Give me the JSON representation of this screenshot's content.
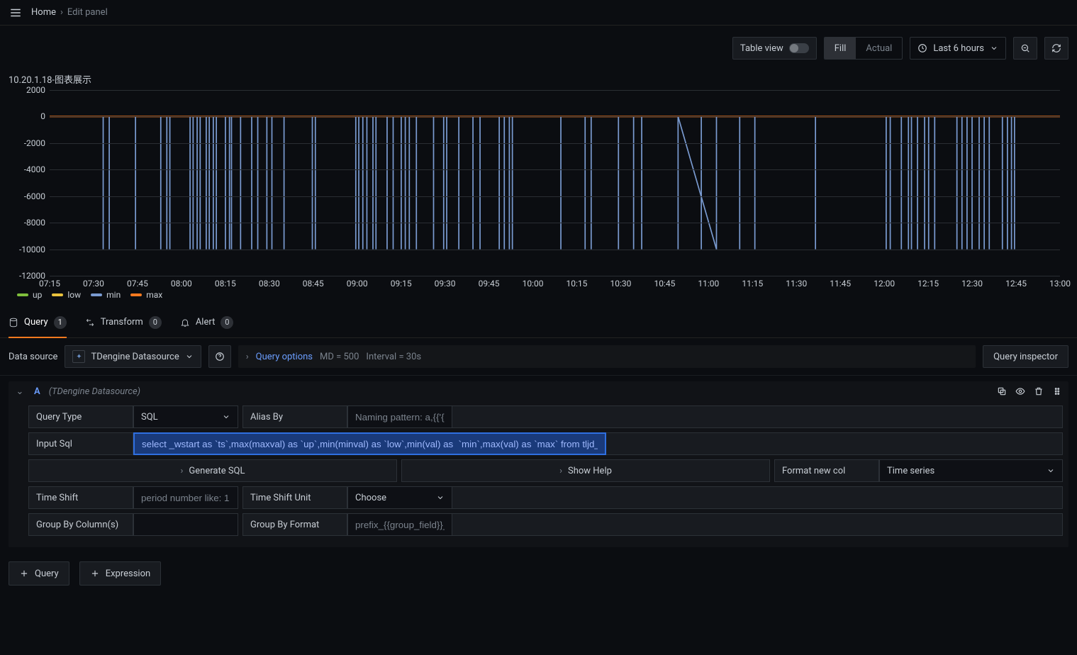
{
  "breadcrumb": {
    "home": "Home",
    "current": "Edit panel"
  },
  "toolbar": {
    "table_view": "Table view",
    "fill": "Fill",
    "actual": "Actual",
    "time_range": "Last 6 hours"
  },
  "panel_title": "10.20.1.18-图表展示",
  "chart_data": {
    "type": "line",
    "title": "10.20.1.18-图表展示",
    "ylabel": "",
    "xlabel": "",
    "ylim": [
      -12000,
      2000
    ],
    "yticks": [
      2000,
      0,
      -2000,
      -4000,
      -6000,
      -8000,
      -10000,
      -12000
    ],
    "xticks": [
      "07:15",
      "07:30",
      "07:45",
      "08:00",
      "08:15",
      "08:30",
      "08:45",
      "09:00",
      "09:15",
      "09:30",
      "09:45",
      "10:00",
      "10:15",
      "10:30",
      "10:45",
      "11:00",
      "11:15",
      "11:30",
      "11:45",
      "12:00",
      "12:15",
      "12:30",
      "12:45",
      "13:00"
    ],
    "series": [
      {
        "name": "up",
        "color": "#7fbe3c",
        "baseline": 0
      },
      {
        "name": "low",
        "color": "#e9c23d",
        "baseline": 0
      },
      {
        "name": "min",
        "color": "#7a9bd1"
      },
      {
        "name": "max",
        "color": "#f5791f",
        "baseline": 0
      }
    ],
    "min_spikes_pct": [
      5.3,
      5.9,
      8.5,
      11.0,
      11.6,
      11.9,
      13.9,
      14.2,
      14.6,
      14.9,
      15.5,
      15.8,
      16.2,
      16.5,
      17.4,
      17.8,
      18.0,
      18.9,
      20.0,
      20.6,
      21.5,
      22.0,
      23.2,
      26.0,
      26.3,
      30.3,
      30.6,
      31.0,
      31.4,
      32.0,
      32.3,
      33.4,
      34.0,
      34.8,
      35.2,
      35.6,
      36.3,
      38.0,
      39.0,
      39.3,
      40.5,
      41.9,
      42.6,
      44.5,
      45.0,
      45.5,
      45.8,
      50.6,
      53.0,
      53.6,
      56.3,
      57.8,
      58.6,
      62.2,
      64.5,
      66.0,
      68.3,
      69.8,
      75.8,
      82.8,
      83.2,
      84.3,
      85.0,
      85.3,
      85.9,
      86.6,
      87.0,
      87.6,
      89.8,
      90.3,
      90.8,
      91.3,
      92.0,
      92.5,
      93.0,
      94.3,
      94.8,
      95.2,
      95.5
    ],
    "min_diagonal_pct": [
      62.2,
      66.0
    ],
    "min_spike_value": -10000
  },
  "legend": [
    {
      "name": "up",
      "color": "#7fbe3c"
    },
    {
      "name": "low",
      "color": "#e9c23d"
    },
    {
      "name": "min",
      "color": "#7a9bd1"
    },
    {
      "name": "max",
      "color": "#f5791f"
    }
  ],
  "tabs": {
    "query": {
      "label": "Query",
      "count": "1"
    },
    "transform": {
      "label": "Transform",
      "count": "0"
    },
    "alert": {
      "label": "Alert",
      "count": "0"
    }
  },
  "datasource": {
    "label": "Data source",
    "value": "TDengine Datasource",
    "query_options": "Query options",
    "md": "MD = 500",
    "interval": "Interval = 30s",
    "inspector": "Query inspector"
  },
  "query_block": {
    "letter": "A",
    "source": "(TDengine Datasource)",
    "query_type_label": "Query Type",
    "query_type_value": "SQL",
    "alias_by_label": "Alias By",
    "alias_placeholder": "Naming pattern: a,{{'{",
    "input_sql_label": "Input Sql",
    "input_sql_value": "select _wstart as `ts`,max(maxval) as `up`,min(minval) as `low`,min(val) as  `min`,max(val) as `max` from tljd_datan.E",
    "generate_sql": "Generate SQL",
    "show_help": "Show Help",
    "format_new_col_label": "Format new col",
    "format_value": "Time series",
    "time_shift_label": "Time Shift",
    "time_shift_placeholder": "period number like: 1",
    "time_shift_unit_label": "Time Shift Unit",
    "time_shift_unit_value": "Choose",
    "group_by_label": "Group By Column(s)",
    "group_by_format_label": "Group By Format",
    "group_by_format_placeholder": "prefix_{{group_field}}_"
  },
  "footer": {
    "add_query": "Query",
    "add_expr": "Expression"
  }
}
